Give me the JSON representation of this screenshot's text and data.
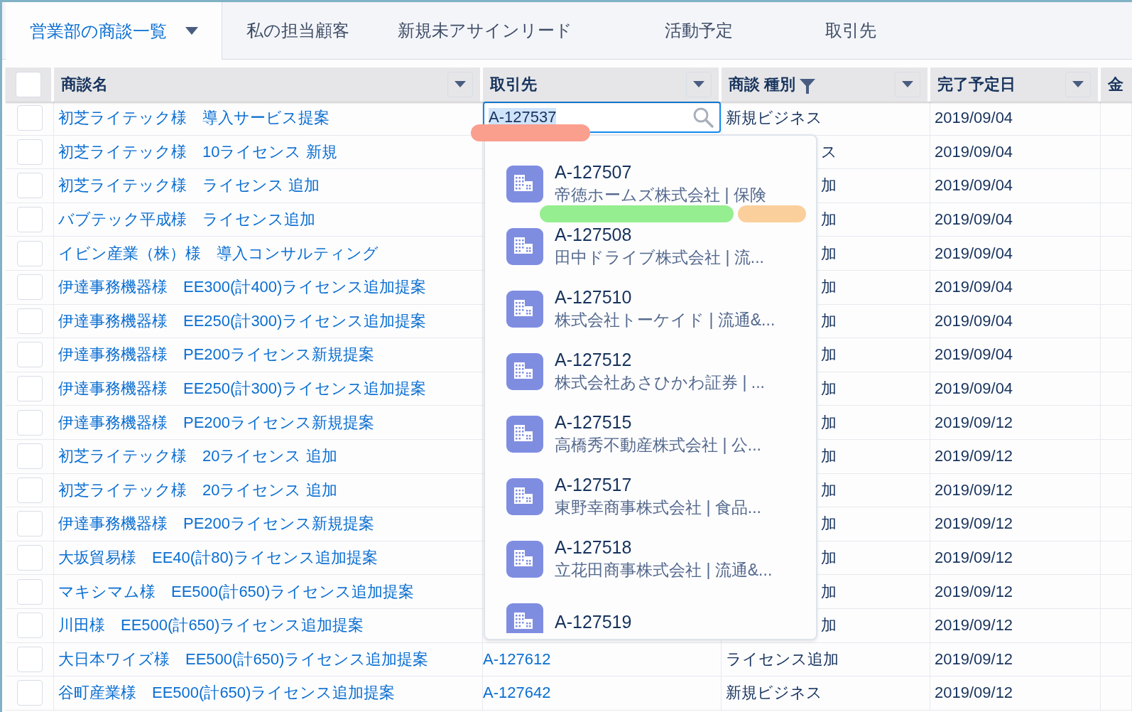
{
  "tabs": [
    {
      "label": "営業部の商談一覧",
      "selected": true,
      "has_menu": true
    },
    {
      "label": "私の担当顧客",
      "selected": false,
      "has_menu": false
    },
    {
      "label": "新規未アサインリード",
      "selected": false,
      "has_menu": false
    },
    {
      "label": "活動予定",
      "selected": false,
      "has_menu": false
    },
    {
      "label": "取引先",
      "selected": false,
      "has_menu": false
    }
  ],
  "table": {
    "columns": [
      {
        "kind": "checkbox",
        "checked": false
      },
      {
        "kind": "menu",
        "label": "商談名"
      },
      {
        "kind": "menu",
        "label": "取引先"
      },
      {
        "kind": "filtered",
        "label": "商談 種別"
      },
      {
        "kind": "menu",
        "label": "完了予定日"
      },
      {
        "kind": "plain",
        "label": "金"
      }
    ],
    "rows": [
      {
        "checked": false,
        "name": "初芝ライテック様　導入サービス提案",
        "editing": true,
        "account": "A-127537",
        "account_highlighted": true,
        "type": "新規ビジネス",
        "close_date": "2019/09/04"
      },
      {
        "checked": false,
        "name": "初芝ライテック様　10ライセンス 新規",
        "type": "ス",
        "close_date": "2019/09/04"
      },
      {
        "checked": false,
        "name": "初芝ライテック様　ライセンス 追加",
        "type": "加",
        "close_date": "2019/09/04"
      },
      {
        "checked": false,
        "name": "バブテック平成様　ライセンス追加",
        "type": "加",
        "close_date": "2019/09/04"
      },
      {
        "checked": false,
        "name": "イビン産業（株）様　導入コンサルティング",
        "type": "加",
        "close_date": "2019/09/04"
      },
      {
        "checked": false,
        "name": "伊達事務機器様　EE300(計400)ライセンス追加提案",
        "type": "加",
        "close_date": "2019/09/04"
      },
      {
        "checked": false,
        "name": "伊達事務機器様　EE250(計300)ライセンス追加提案",
        "type": "加",
        "close_date": "2019/09/04"
      },
      {
        "checked": false,
        "name": "伊達事務機器様　PE200ライセンス新規提案",
        "type": "加",
        "close_date": "2019/09/04"
      },
      {
        "checked": false,
        "name": "伊達事務機器様　EE250(計300)ライセンス追加提案",
        "type": "加",
        "close_date": "2019/09/04"
      },
      {
        "checked": false,
        "name": "伊達事務機器様　PE200ライセンス新規提案",
        "type": "加",
        "close_date": "2019/09/12"
      },
      {
        "checked": false,
        "name": "初芝ライテック様　20ライセンス 追加",
        "type": "加",
        "close_date": "2019/09/12"
      },
      {
        "checked": false,
        "name": "初芝ライテック様　20ライセンス 追加",
        "type": "加",
        "close_date": "2019/09/12"
      },
      {
        "checked": false,
        "name": "伊達事務機器様　PE200ライセンス新規提案",
        "type": "加",
        "close_date": "2019/09/12"
      },
      {
        "checked": false,
        "name": "大坂貿易様　EE40(計80)ライセンス追加提案",
        "type": "加",
        "close_date": "2019/09/12"
      },
      {
        "checked": false,
        "name": "マキシマム様　EE500(計650)ライセンス追加提案",
        "type": "加",
        "close_date": "2019/09/12"
      },
      {
        "checked": false,
        "name": "川田様　EE500(計650)ライセンス追加提案",
        "type": "加",
        "close_date": "2019/09/12"
      },
      {
        "checked": false,
        "name": "大日本ワイズ様　EE500(計650)ライセンス追加提案",
        "account": "A-127612",
        "type": "ライセンス追加",
        "close_date": "2019/09/12"
      },
      {
        "checked": false,
        "name": "谷町産業様　EE500(計650)ライセンス追加提案",
        "account": "A-127642",
        "type": "新規ビジネス",
        "close_date": "2019/09/12"
      }
    ]
  },
  "lookup": {
    "results": [
      {
        "title": "A-127507",
        "subtitle": "帝徳ホームズ株式会社 | 保険"
      },
      {
        "title": "A-127508",
        "subtitle": "田中ドライブ株式会社 | 流..."
      },
      {
        "title": "A-127510",
        "subtitle": "株式会社トーケイド | 流通&..."
      },
      {
        "title": "A-127512",
        "subtitle": "株式会社あさひかわ証券 | ..."
      },
      {
        "title": "A-127515",
        "subtitle": "高橋秀不動産株式会社 | 公..."
      },
      {
        "title": "A-127517",
        "subtitle": "東野幸商事株式会社 | 食品..."
      },
      {
        "title": "A-127518",
        "subtitle": "立花田商事株式会社 | 流通&..."
      },
      {
        "title": "A-127519"
      }
    ]
  },
  "highlights": [
    {
      "color": "#fa9e8e"
    },
    {
      "color": "#95ee8f"
    },
    {
      "color": "#fbcf9c"
    }
  ]
}
